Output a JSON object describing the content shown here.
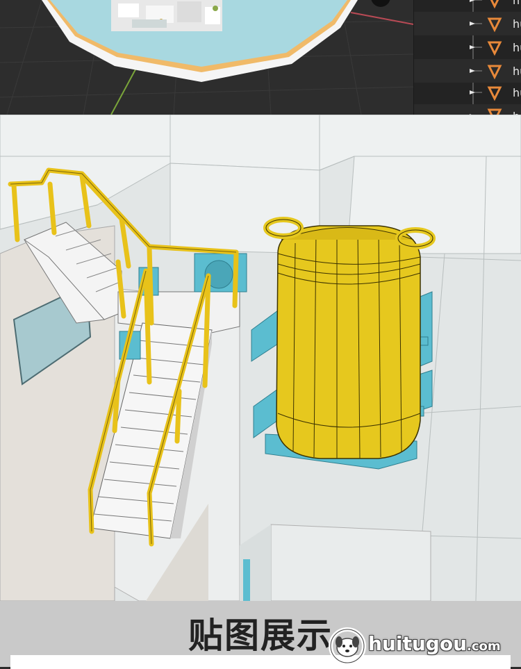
{
  "outliner": {
    "rows": [
      {
        "label": "h"
      },
      {
        "label": "hu"
      },
      {
        "label": "hu"
      },
      {
        "label": "hu"
      },
      {
        "label": "hu"
      },
      {
        "label": "h"
      }
    ],
    "icon_color": "#e8893a"
  },
  "footer": {
    "title": "贴图展示"
  },
  "watermark": {
    "brand": "huitugou",
    "suffix": ".com"
  },
  "colors": {
    "viewport_bg": "#2d2d2d",
    "scene_bg": "#d4d8d8",
    "railing": "#e8c21a",
    "tank": "#e6c81e",
    "accent_cyan": "#5bbdd0",
    "footer_bg": "#c9c9c9"
  }
}
